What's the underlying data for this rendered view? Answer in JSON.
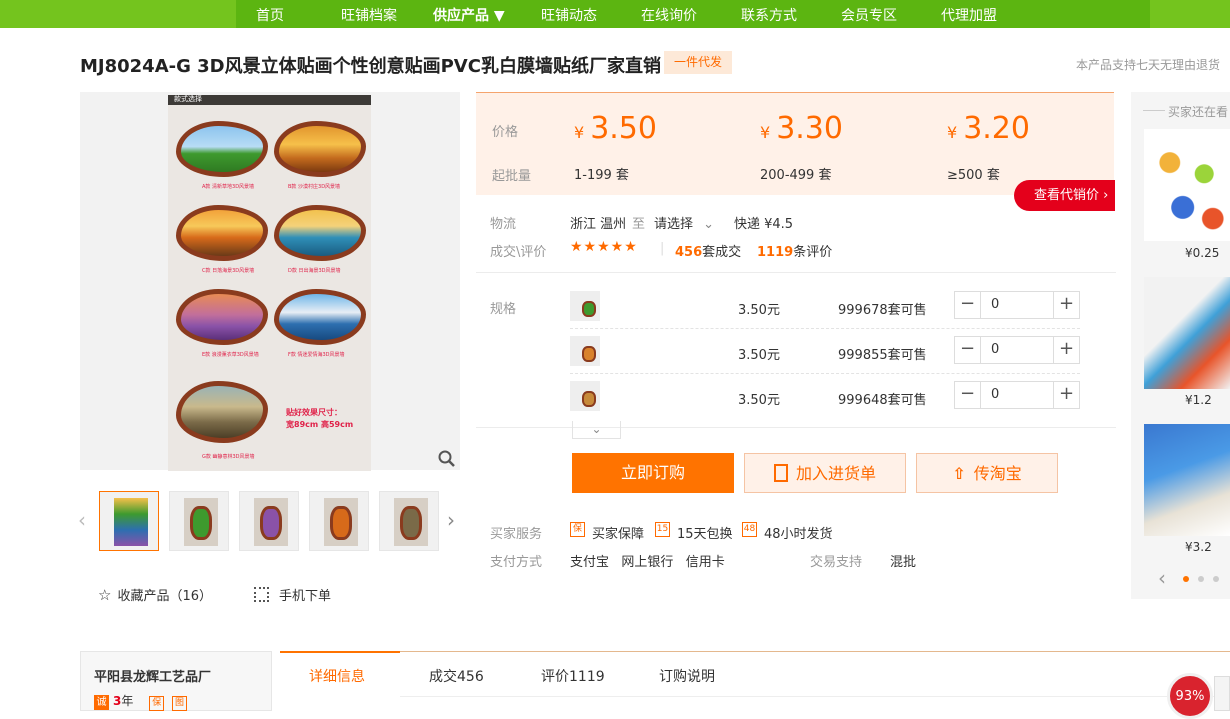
{
  "nav": {
    "items": [
      "首页",
      "旺铺档案",
      "供应产品 ▼",
      "旺铺动态",
      "在线询价",
      "联系方式",
      "会员专区",
      "代理加盟"
    ],
    "active_index": 2
  },
  "product": {
    "title": "MJ8024A-G 3D风景立体贴画个性创意贴画PVC乳白膜墙贴纸厂家直销",
    "dropship_badge": "一件代发",
    "return_note": "本产品支持七天无理由退货"
  },
  "poster": {
    "header": "款式选择",
    "labels": [
      "A款 清新草地3D风景墙",
      "B款 沙漠村庄3D风景墙",
      "C款 日落海景3D风景墙",
      "D款 日出海景3D风景墙",
      "E款 浪漫薰衣草3D风景墙",
      "F款 情迷爱情海3D风景墙",
      "G款 幽静意林3D风景墙"
    ],
    "note_line1": "贴好效果尺寸：",
    "note_line2": "宽89cm 高59cm"
  },
  "gallery": {
    "prev": "‹",
    "next": "›",
    "thumb_count": 5
  },
  "actions": {
    "favorite": "收藏产品（16）",
    "mobile_order": "手机下单"
  },
  "pricing": {
    "price_label": "价格",
    "batch_label": "起批量",
    "currency": "¥",
    "tiers": [
      {
        "price": "3.50",
        "range": "1-199 套"
      },
      {
        "price": "3.30",
        "range": "200-499 套"
      },
      {
        "price": "3.20",
        "range": "≥500 套"
      }
    ],
    "agent_price_button": "查看代销价 ›"
  },
  "logistics": {
    "label": "物流",
    "origin": "浙江 温州",
    "to": "至",
    "destination": "请选择",
    "shipping": "快递 ¥4.5"
  },
  "deals": {
    "label": "成交\\评价",
    "stars": "★★★★★",
    "sold_count": "456",
    "sold_suffix": "套成交",
    "review_count": "1119",
    "review_suffix": "条评价"
  },
  "specs": {
    "label": "规格",
    "rows": [
      {
        "price": "3.50元",
        "stock": "999678套可售",
        "qty": "0"
      },
      {
        "price": "3.50元",
        "stock": "999855套可售",
        "qty": "0"
      },
      {
        "price": "3.50元",
        "stock": "999648套可售",
        "qty": "0"
      }
    ],
    "minus": "−",
    "plus": "+",
    "expand": "⌄"
  },
  "buttons": {
    "buy_now": "立即订购",
    "add_to_list": "加入进货单",
    "to_taobao": "传淘宝"
  },
  "service": {
    "label": "买家服务",
    "items": [
      "买家保障",
      "15天包换",
      "48小时发货"
    ],
    "icons": [
      "保",
      "15",
      "48"
    ]
  },
  "payment": {
    "label": "支付方式",
    "methods": "支付宝   网上银行   信用卡",
    "trade_label": "交易支持",
    "trade_value": "混批"
  },
  "recommendations": {
    "title": "买家还在看",
    "items": [
      {
        "price": "¥0.25"
      },
      {
        "price": "¥1.2"
      },
      {
        "price": "¥3.2"
      }
    ],
    "prev": "‹"
  },
  "shop": {
    "name": "平阳县龙辉工艺品厂",
    "years_icon": "诚",
    "years_num": "3",
    "years_unit": "年",
    "badges": [
      "保",
      "图"
    ]
  },
  "tabs": [
    "详细信息",
    "成交456",
    "评价1119",
    "订购说明"
  ],
  "speed_badge": "93%",
  "colors": {
    "accent": "#ff6a00",
    "nav_green": "#74c41e",
    "agent_red": "#e4001b"
  }
}
